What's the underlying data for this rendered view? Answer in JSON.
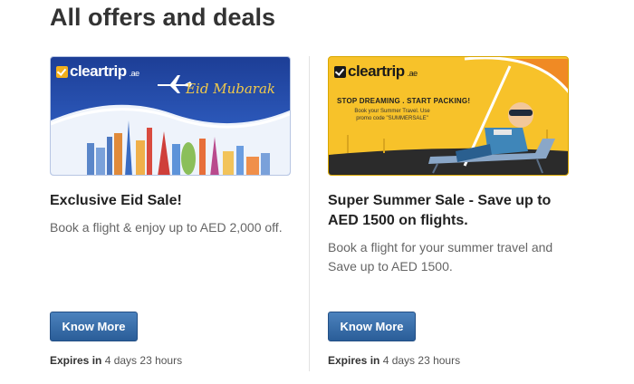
{
  "page": {
    "title": "All offers and deals"
  },
  "offers": [
    {
      "banner": {
        "logo_text": "cleartrip",
        "logo_tld": ".ae",
        "script_text": "Eid Mubarak"
      },
      "title": "Exclusive Eid Sale!",
      "description": "Book a flight & enjoy up to AED 2,000 off.",
      "button_label": "Know More",
      "expires_label": "Expires in",
      "expires_value": "4 days 23 hours"
    },
    {
      "banner": {
        "logo_text": "cleartrip",
        "logo_tld": ".ae",
        "headline": "STOP DREAMING . START PACKING!",
        "subtext": "Book your Summer Travel. Use promo code \"SUMMERSALE\""
      },
      "title": "Super Summer Sale - Save up to AED 1500 on flights.",
      "description": "Book a flight for your summer travel and Save up to AED 1500.",
      "button_label": "Know More",
      "expires_label": "Expires in",
      "expires_value": "4 days 23 hours"
    }
  ],
  "colors": {
    "button_top": "#4b82bd",
    "button_bottom": "#2a5d98",
    "eid_banner_blue": "#1d3e96",
    "summer_banner_yellow": "#f7c22a"
  }
}
